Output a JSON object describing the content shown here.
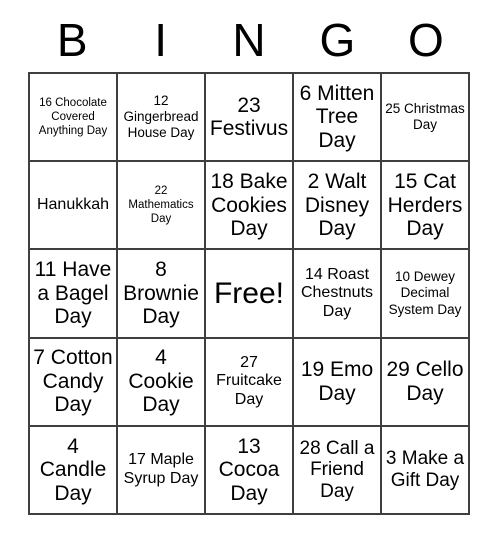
{
  "card": {
    "title": "BINGO",
    "header_letters": [
      "B",
      "I",
      "N",
      "G",
      "O"
    ],
    "free_space_label": "Free!",
    "grid_color": "#3f3f3f",
    "background_color": "#ffffff",
    "text_color": "#000000",
    "columns": 5,
    "rows": 5
  },
  "rows": [
    {
      "cells": [
        {
          "text": "16 Chocolate Covered Anything Day",
          "size": "fs-xs"
        },
        {
          "text": "12 Gingerbread House Day",
          "size": "fs-sm"
        },
        {
          "text": "23 Festivus",
          "size": "fs-xl"
        },
        {
          "text": "6 Mitten Tree Day",
          "size": "fs-xl"
        },
        {
          "text": "25 Christmas Day",
          "size": "fs-sm"
        }
      ]
    },
    {
      "cells": [
        {
          "text": "Hanukkah",
          "size": "fs-md"
        },
        {
          "text": "22 Mathematics Day",
          "size": "fs-xs"
        },
        {
          "text": "18 Bake Cookies Day",
          "size": "fs-xl"
        },
        {
          "text": "2 Walt Disney Day",
          "size": "fs-xl"
        },
        {
          "text": "15 Cat Herders Day",
          "size": "fs-xl"
        }
      ]
    },
    {
      "cells": [
        {
          "text": "11 Have a Bagel Day",
          "size": "fs-xl"
        },
        {
          "text": "8 Brownie Day",
          "size": "fs-xl"
        },
        {
          "text": "Free!",
          "size": "fs-free"
        },
        {
          "text": "14 Roast Chestnuts Day",
          "size": "fs-md"
        },
        {
          "text": "10 Dewey Decimal System Day",
          "size": "fs-sm"
        }
      ]
    },
    {
      "cells": [
        {
          "text": "7 Cotton Candy Day",
          "size": "fs-xl"
        },
        {
          "text": "4 Cookie Day",
          "size": "fs-xl"
        },
        {
          "text": "27 Fruitcake Day",
          "size": "fs-md"
        },
        {
          "text": "19 Emo Day",
          "size": "fs-xl"
        },
        {
          "text": "29 Cello Day",
          "size": "fs-xl"
        }
      ]
    },
    {
      "cells": [
        {
          "text": "4 Candle Day",
          "size": "fs-xl"
        },
        {
          "text": "17 Maple Syrup Day",
          "size": "fs-md"
        },
        {
          "text": "13 Cocoa Day",
          "size": "fs-xl"
        },
        {
          "text": "28 Call a Friend Day",
          "size": "fs-lg"
        },
        {
          "text": "3 Make a Gift Day",
          "size": "fs-lg"
        }
      ]
    }
  ]
}
